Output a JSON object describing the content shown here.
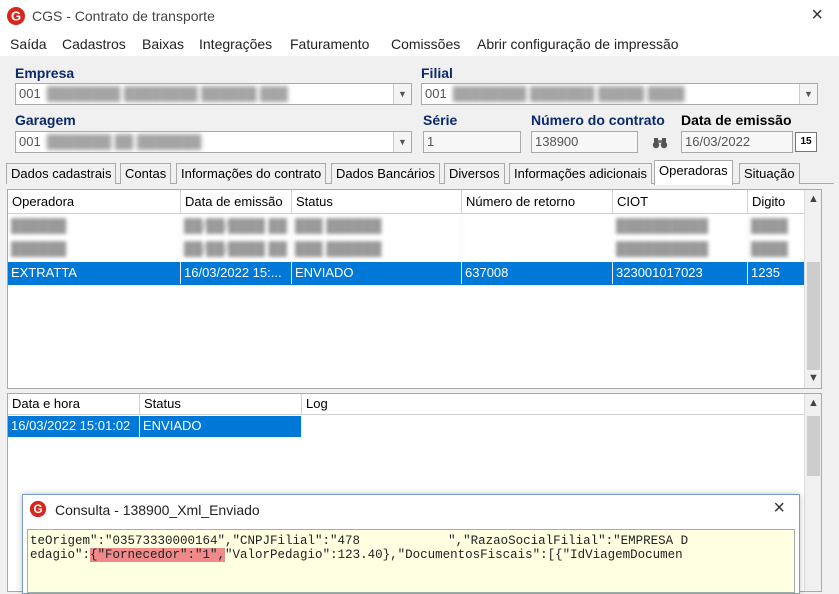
{
  "window": {
    "title": "CGS - Contrato de transporte",
    "close_icon": "×"
  },
  "menu": [
    "Saída",
    "Cadastros",
    "Baixas",
    "Integrações",
    "Faturamento",
    "Comissões",
    "Abrir configuração de impressão"
  ],
  "form": {
    "empresa_label": "Empresa",
    "empresa_code": "001",
    "filial_label": "Filial",
    "filial_code": "001",
    "garagem_label": "Garagem",
    "garagem_code": "001",
    "serie_label": "Série",
    "serie_value": "1",
    "numero_label": "Número do contrato",
    "numero_value": "138900",
    "data_label": "Data de emissão",
    "data_value": "16/03/2022",
    "calendar_icon": "15"
  },
  "tabs": [
    "Dados cadastrais",
    "Contas",
    "Informações do contrato",
    "Dados Bancários",
    "Diversos",
    "Informações adicionais",
    "Operadoras",
    "Situação"
  ],
  "operadoras": {
    "headers": [
      "Operadora",
      "Data de emissão",
      "Status",
      "Número de retorno",
      "CIOT",
      "Digito"
    ],
    "selected_row": [
      "EXTRATTA",
      "16/03/2022 15:...",
      "ENVIADO",
      "637008",
      "323001017023",
      "1235"
    ]
  },
  "log": {
    "headers": [
      "Data e hora",
      "Status",
      "Log"
    ],
    "selected_row": [
      "16/03/2022 15:01:02",
      "ENVIADO",
      ""
    ]
  },
  "popup": {
    "title": "Consulta - 138900_Xml_Enviado",
    "close_icon": "×",
    "line1_a": "teOrigem\":\"03573330000164\",\"CNPJFilial\":\"478",
    "line1_b": "\",\"RazaoSocialFilial\":\"EMPRESA D",
    "line2_a": "edagio\":",
    "line2_hl": "{\"Fornecedor\":\"1\",",
    "line2_b": "\"ValorPedagio\":123.40},\"DocumentosFiscais\":[{\"IdViagemDocumen"
  }
}
